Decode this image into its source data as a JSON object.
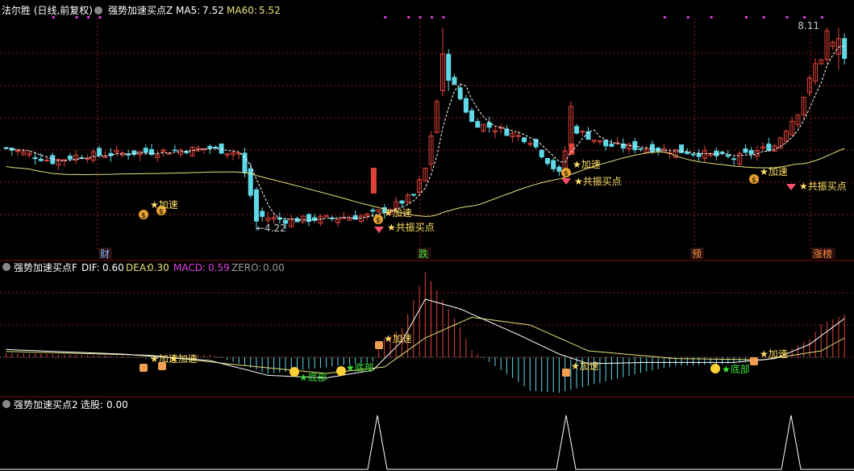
{
  "colors": {
    "bg": "#000000",
    "up": "#e0433a",
    "down": "#5fd9e8",
    "ma5": "#ffffff",
    "ma60": "#e8e27a",
    "grid": "#8a1f1f",
    "sep": "#7a1010",
    "label": "#ffffff",
    "dif": "#ffffff",
    "dea": "#e8e27a",
    "macd": "#e040e0",
    "zero": "#9a9a9a",
    "buy": "#ffe066",
    "resonance": "#ffe066",
    "bottom": "#3ce63c",
    "dot": "#d840d8"
  },
  "panel1": {
    "title": "法尔胜 (日线,前复权)",
    "indicator": "强势加速买点Z",
    "ma5_label": "MA5:",
    "ma5_value": "7.52",
    "ma60_label": "MA60:",
    "ma60_value": "5.52",
    "high_label": "8.11",
    "low_label": "4.22",
    "markers": {
      "accel": "★加速",
      "resonance": "★共振买点"
    },
    "bottom_tags": [
      "财",
      "跌",
      "预",
      "涨榜"
    ]
  },
  "panel2": {
    "indicator": "强势加速买点F",
    "dif_label": "DIF:",
    "dif_value": "0.60",
    "dea_label": "DEA:",
    "dea_value": "0.30",
    "macd_label": "MACD:",
    "macd_value": "0.59",
    "zero_label": "ZERO:",
    "zero_value": "0.00",
    "markers": {
      "accel": "★加速",
      "bottom": "★底部"
    }
  },
  "panel3": {
    "indicator": "强势加速买点2",
    "select_label": "选股:",
    "select_value": "0.00"
  },
  "icons": [
    "chevron-down-icon",
    "money-bag-icon",
    "diamond-icon",
    "smiley-icon",
    "scroll-icon"
  ],
  "chart_data": {
    "type": "candlestick",
    "bars": 145,
    "price_range": [
      4.0,
      8.3
    ],
    "annotations": {
      "max_close": 8.11,
      "min_low": 4.22
    },
    "macd": {
      "dif": 0.6,
      "dea": 0.3,
      "macd": 0.59
    },
    "select": {
      "value": 0.0,
      "signal_bars": 3
    }
  }
}
